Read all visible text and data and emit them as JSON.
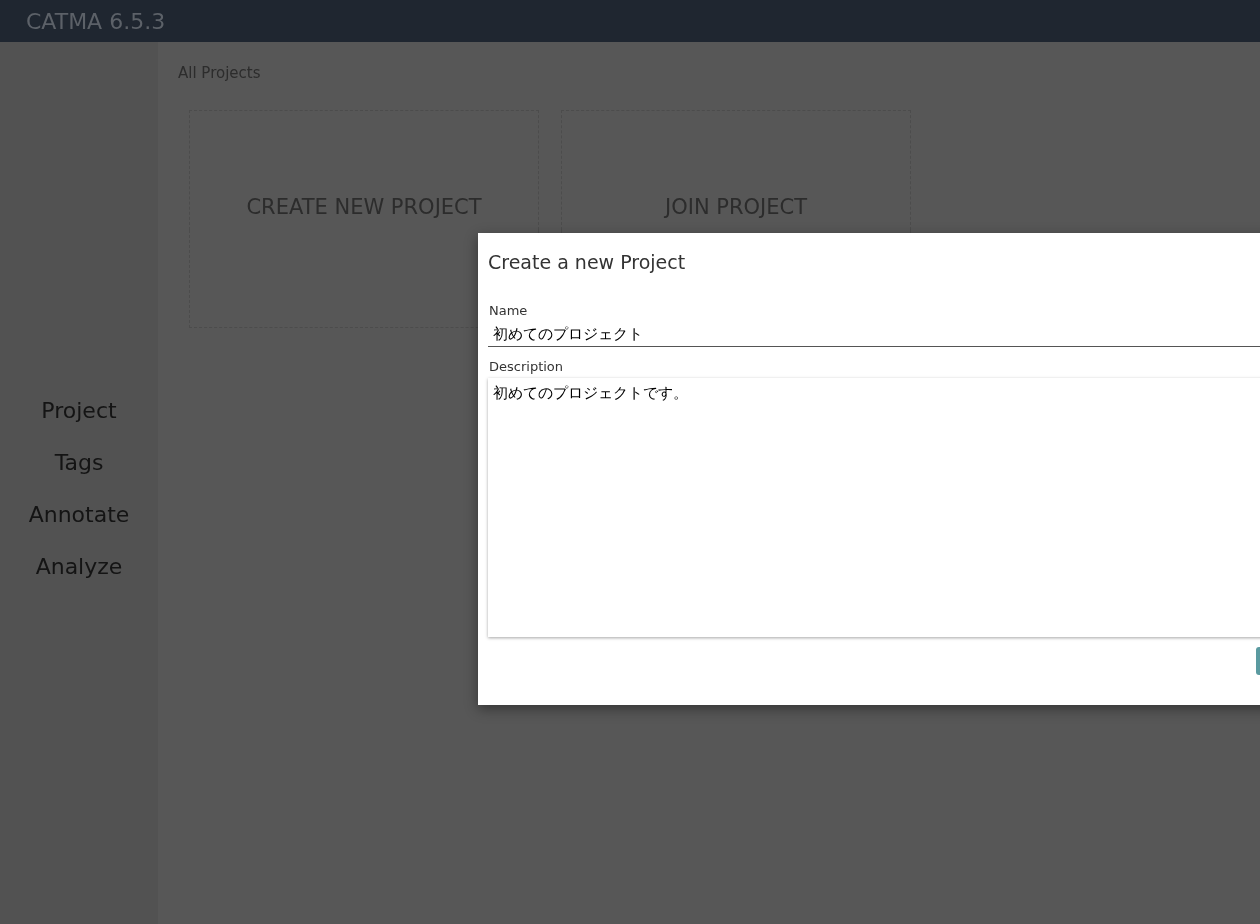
{
  "app_title": "CATMA 6.5.3",
  "breadcrumb": "All Projects",
  "cards": [
    {
      "label": "CREATE NEW PROJECT"
    },
    {
      "label": "JOIN PROJECT"
    }
  ],
  "nav": [
    {
      "label": "Project"
    },
    {
      "label": "Tags"
    },
    {
      "label": "Annotate"
    },
    {
      "label": "Analyze"
    }
  ],
  "dialog": {
    "title": "Create a new Project",
    "name_label": "Name",
    "name_value": "初めてのプロジェクト",
    "description_label": "Description",
    "description_value": "初めてのプロジェクトです。"
  }
}
